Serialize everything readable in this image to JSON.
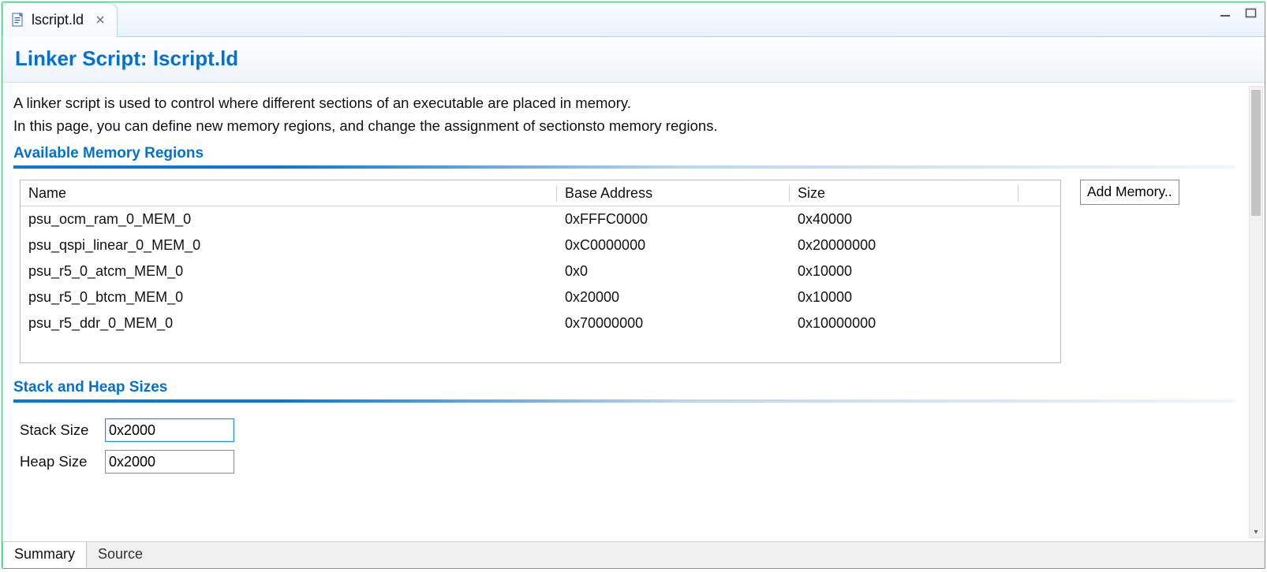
{
  "tab": {
    "filename": "lscript.ld"
  },
  "title": "Linker Script: lscript.ld",
  "description_line1": "A linker script is used to control where different sections of an executable are placed in memory.",
  "description_line2": "In this page, you can define new memory regions, and change the assignment of sectionsto memory regions.",
  "sections": {
    "regions_title": "Available Memory Regions",
    "stackheap_title": "Stack and Heap Sizes"
  },
  "regions": {
    "columns": {
      "name": "Name",
      "base": "Base Address",
      "size": "Size"
    },
    "rows": [
      {
        "name": "psu_ocm_ram_0_MEM_0",
        "base": "0xFFFC0000",
        "size": "0x40000"
      },
      {
        "name": "psu_qspi_linear_0_MEM_0",
        "base": "0xC0000000",
        "size": "0x20000000"
      },
      {
        "name": "psu_r5_0_atcm_MEM_0",
        "base": "0x0",
        "size": "0x10000"
      },
      {
        "name": "psu_r5_0_btcm_MEM_0",
        "base": "0x20000",
        "size": "0x10000"
      },
      {
        "name": "psu_r5_ddr_0_MEM_0",
        "base": "0x70000000",
        "size": "0x10000000"
      }
    ],
    "add_button": "Add Memory.."
  },
  "stackheap": {
    "stack_label": "Stack Size",
    "stack_value": "0x2000",
    "heap_label": "Heap Size",
    "heap_value": "0x2000"
  },
  "bottom_tabs": {
    "summary": "Summary",
    "source": "Source"
  }
}
